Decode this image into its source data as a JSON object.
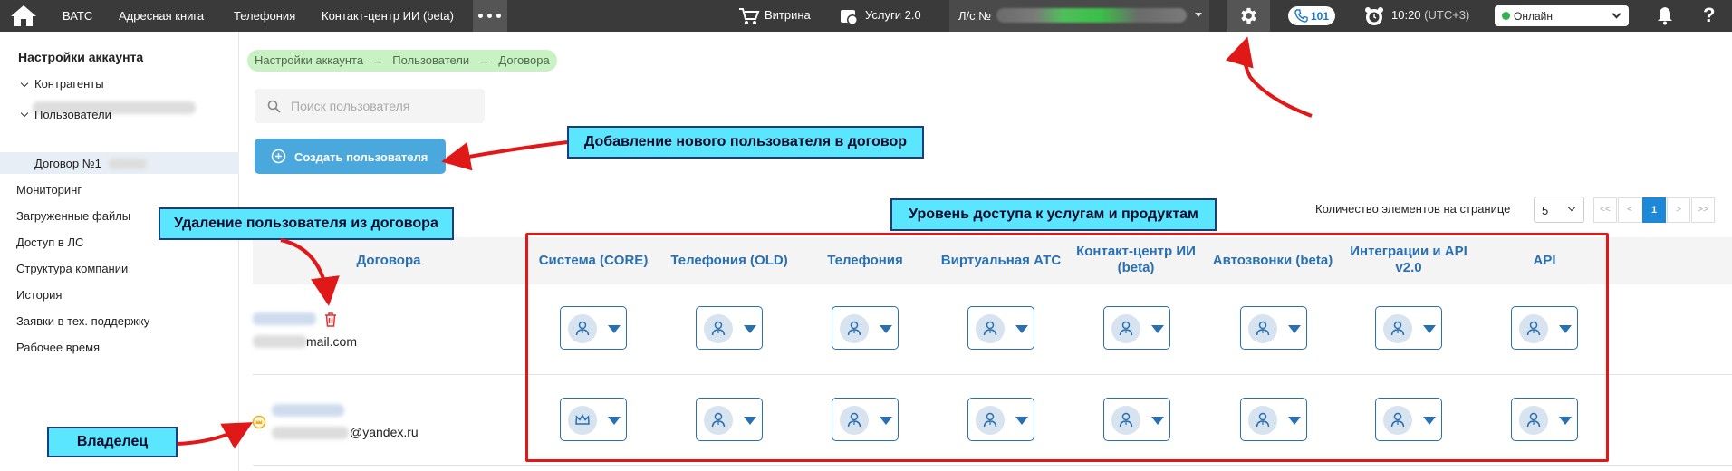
{
  "topbar": {
    "nav": [
      "ВАТС",
      "Адресная книга",
      "Телефония",
      "Контакт-центр ИИ (beta)"
    ],
    "more_label": "•••",
    "shop_label": "Витрина",
    "services_label": "Услуги 2.0",
    "account_label": "Л/с №",
    "phone_count": "101",
    "time": "10:20",
    "timezone": "(UTC+3)",
    "status": "Онлайн",
    "help": "?"
  },
  "sidebar": {
    "title": "Настройки аккаунта",
    "items": [
      {
        "label": "Контрагенты"
      },
      {
        "label": "Пользователи"
      },
      {
        "label": "Договор №1"
      },
      {
        "label": "Мониторинг"
      },
      {
        "label": "Загруженные файлы"
      },
      {
        "label": "Доступ в ЛС"
      },
      {
        "label": "Структура компании"
      },
      {
        "label": "История"
      },
      {
        "label": "Заявки в тех. поддержку"
      },
      {
        "label": "Рабочее время"
      }
    ]
  },
  "breadcrumb": [
    "Настройки аккаунта",
    "Пользователи",
    "Договора"
  ],
  "breadcrumb_sep": "→",
  "search": {
    "placeholder": "Поиск пользователя"
  },
  "create_button": "Создать пользователя",
  "pagination": {
    "per_page_label": "Количество элементов на странице",
    "per_page_value": "5",
    "first": "<<",
    "prev": "<",
    "current": "1",
    "next": ">",
    "last": ">>"
  },
  "table": {
    "columns": [
      "Договора",
      "Система (CORE)",
      "Телефония (OLD)",
      "Телефония",
      "Виртуальная АТС",
      "Контакт-центр ИИ (beta)",
      "Автозвонки (beta)",
      "Интеграции и API v2.0",
      "API"
    ],
    "rows": [
      {
        "email_suffix": "mail.com",
        "role_icons": [
          "user-icon",
          "user-icon",
          "user-icon",
          "user-icon",
          "user-icon",
          "user-icon",
          "user-icon",
          "user-icon"
        ]
      },
      {
        "email_suffix": "@yandex.ru",
        "role_icons": [
          "crown-icon",
          "user-icon",
          "user-icon",
          "user-icon",
          "user-icon",
          "user-icon",
          "user-icon",
          "user-icon"
        ]
      }
    ]
  },
  "annotations": {
    "add_user": "Добавление нового пользователя в договор",
    "access_level": "Уровень доступа к услугам и продуктам",
    "delete_user": "Удаление пользователя из договора",
    "owner": "Владелец"
  },
  "colors": {
    "topbar": "#3a3a3a",
    "accent": "#1e88d8",
    "header_text": "#2a6fb0",
    "callout": "#5be6ff",
    "arrow": "#e01818"
  }
}
